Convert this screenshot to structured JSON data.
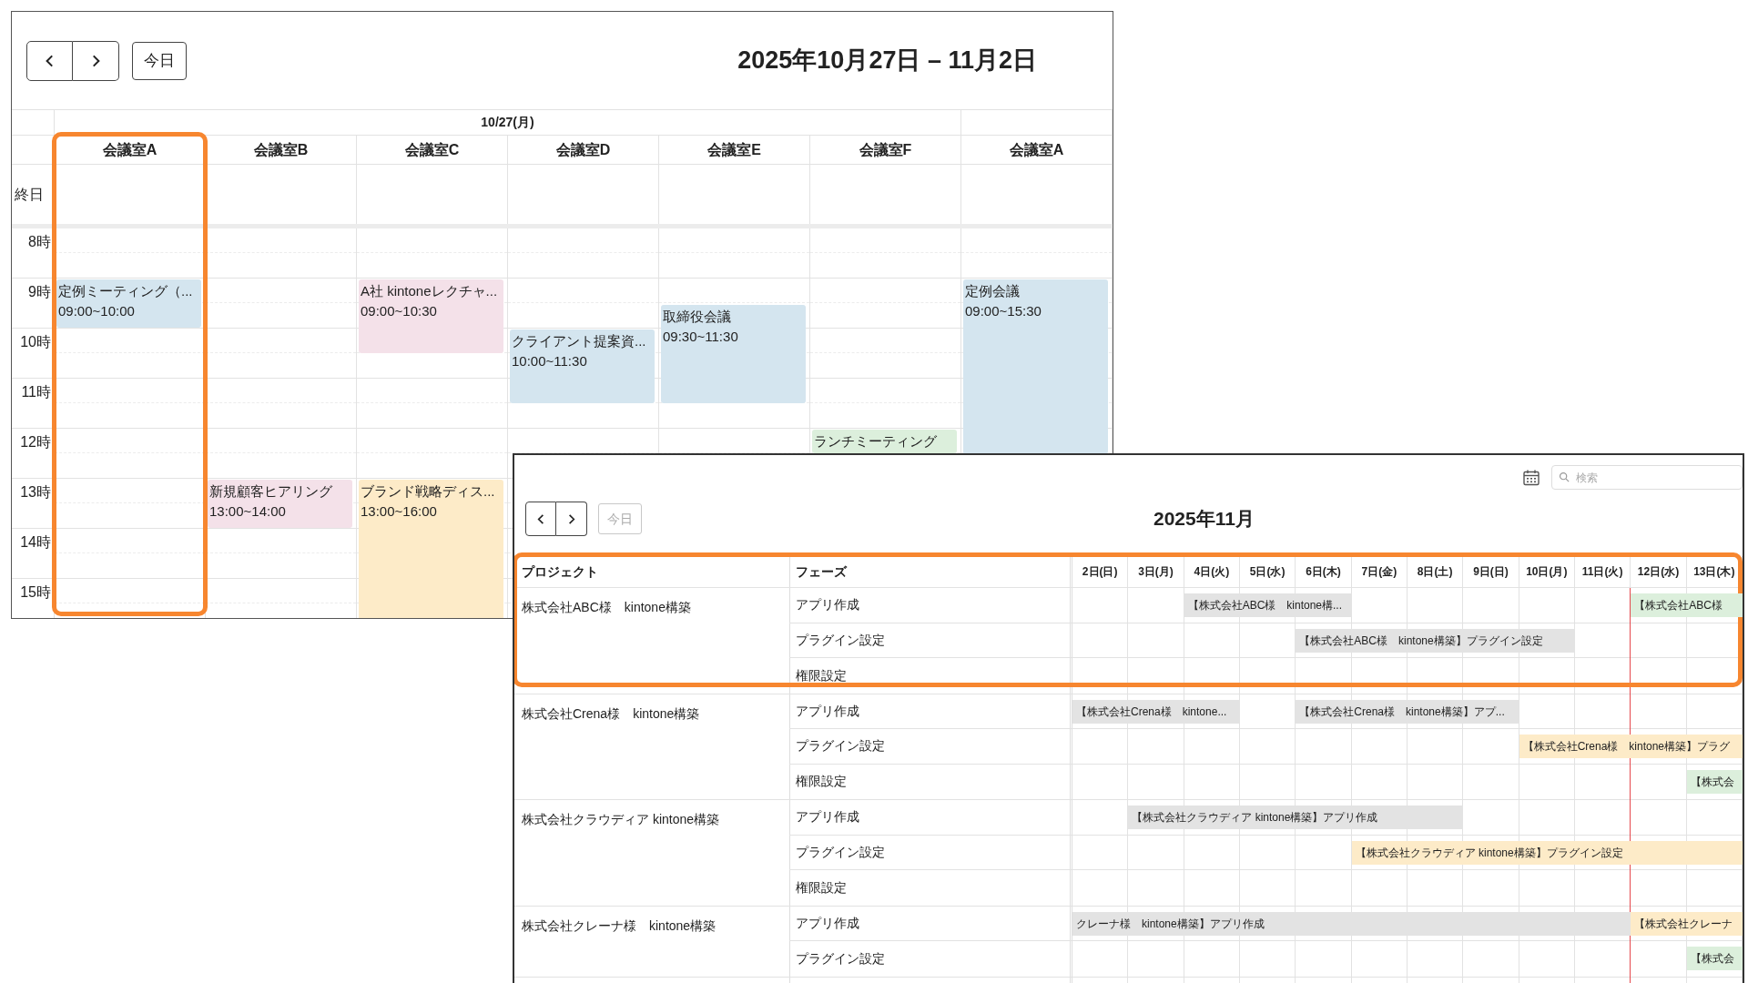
{
  "room_calendar": {
    "today_button": {
      "label": "今日",
      "disabled": false
    },
    "title": "2025年10月27日 – 11月2日",
    "all_day_label": "終日",
    "hours": [
      "8時",
      "9時",
      "10時",
      "11時",
      "12時",
      "13時",
      "14時",
      "15時"
    ],
    "date_groups": [
      {
        "label": "10/27(月)",
        "rooms": [
          {
            "name": "会議室A",
            "highlighted": true,
            "slots": [
              {
                "kind": "free"
              },
              {
                "kind": "free"
              },
              {
                "kind": "event",
                "title": "定例ミーティング（...",
                "time": "09:00~10:00",
                "color": "#d4e5ef"
              },
              {
                "kind": "continued"
              },
              {
                "kind": "free"
              },
              {
                "kind": "free"
              },
              {
                "kind": "free"
              },
              {
                "kind": "free"
              },
              {
                "kind": "free"
              },
              {
                "kind": "free"
              },
              {
                "kind": "free"
              },
              {
                "kind": "free"
              },
              {
                "kind": "free"
              },
              {
                "kind": "free"
              },
              {
                "kind": "free"
              },
              {
                "kind": "free"
              }
            ]
          },
          {
            "name": "会議室B",
            "highlighted": false,
            "slots": [
              {
                "kind": "free"
              },
              {
                "kind": "free"
              },
              {
                "kind": "free"
              },
              {
                "kind": "free"
              },
              {
                "kind": "free"
              },
              {
                "kind": "free"
              },
              {
                "kind": "free"
              },
              {
                "kind": "free"
              },
              {
                "kind": "free"
              },
              {
                "kind": "free"
              },
              {
                "kind": "event",
                "title": "新規顧客ヒアリング",
                "time": "13:00~14:00",
                "color": "#f4e1e9"
              },
              {
                "kind": "continued"
              },
              {
                "kind": "free"
              },
              {
                "kind": "free"
              },
              {
                "kind": "free"
              },
              {
                "kind": "free"
              }
            ]
          },
          {
            "name": "会議室C",
            "highlighted": false,
            "slots": [
              {
                "kind": "free"
              },
              {
                "kind": "free"
              },
              {
                "kind": "event",
                "title": "A社 kintoneレクチャ...",
                "time": "09:00~10:30",
                "color": "#f4e1e9"
              },
              {
                "kind": "continued"
              },
              {
                "kind": "continued"
              },
              {
                "kind": "free"
              },
              {
                "kind": "free"
              },
              {
                "kind": "free"
              },
              {
                "kind": "free"
              },
              {
                "kind": "free"
              },
              {
                "kind": "event",
                "title": "ブランド戦略ディス...",
                "time": "13:00~16:00",
                "color": "#fdebc8"
              },
              {
                "kind": "continued"
              },
              {
                "kind": "continued"
              },
              {
                "kind": "continued"
              },
              {
                "kind": "continued"
              },
              {
                "kind": "continued"
              }
            ]
          },
          {
            "name": "会議室D",
            "highlighted": false,
            "slots": [
              {
                "kind": "free"
              },
              {
                "kind": "free"
              },
              {
                "kind": "free"
              },
              {
                "kind": "free"
              },
              {
                "kind": "event",
                "title": "クライアント提案資...",
                "time": "10:00~11:30",
                "color": "#d4e5ef"
              },
              {
                "kind": "continued"
              },
              {
                "kind": "continued"
              },
              {
                "kind": "free"
              },
              {
                "kind": "free"
              },
              {
                "kind": "free"
              },
              {
                "kind": "free"
              },
              {
                "kind": "free"
              },
              {
                "kind": "free"
              },
              {
                "kind": "free"
              },
              {
                "kind": "free"
              },
              {
                "kind": "free"
              }
            ]
          },
          {
            "name": "会議室E",
            "highlighted": false,
            "slots": [
              {
                "kind": "free"
              },
              {
                "kind": "free"
              },
              {
                "kind": "free"
              },
              {
                "kind": "event",
                "title": "取締役会議",
                "time": "09:30~11:30",
                "color": "#d4e5ef"
              },
              {
                "kind": "continued"
              },
              {
                "kind": "continued"
              },
              {
                "kind": "continued"
              },
              {
                "kind": "free"
              },
              {
                "kind": "free"
              },
              {
                "kind": "free"
              },
              {
                "kind": "free"
              },
              {
                "kind": "free"
              },
              {
                "kind": "free"
              },
              {
                "kind": "free"
              },
              {
                "kind": "free"
              },
              {
                "kind": "free"
              }
            ]
          },
          {
            "name": "会議室F",
            "highlighted": false,
            "slots": [
              {
                "kind": "free"
              },
              {
                "kind": "free"
              },
              {
                "kind": "free"
              },
              {
                "kind": "free"
              },
              {
                "kind": "free"
              },
              {
                "kind": "free"
              },
              {
                "kind": "free"
              },
              {
                "kind": "free"
              },
              {
                "kind": "event",
                "title": "ランチミーティング",
                "color": "#dcefdc"
              },
              {
                "kind": "free"
              },
              {
                "kind": "free"
              },
              {
                "kind": "free"
              },
              {
                "kind": "free"
              },
              {
                "kind": "free"
              },
              {
                "kind": "free"
              },
              {
                "kind": "free"
              }
            ]
          }
        ]
      },
      {
        "rooms": [
          {
            "name": "会議室A",
            "highlighted": false,
            "slots": [
              {
                "kind": "free"
              },
              {
                "kind": "free"
              },
              {
                "kind": "event",
                "title": "定例会議",
                "time": "09:00~15:30",
                "color": "#d4e5ef"
              },
              {
                "kind": "continued"
              },
              {
                "kind": "continued"
              },
              {
                "kind": "continued"
              },
              {
                "kind": "continued"
              },
              {
                "kind": "continued"
              },
              {
                "kind": "continued"
              },
              {
                "kind": "continued"
              },
              {
                "kind": "continued"
              },
              {
                "kind": "continued"
              },
              {
                "kind": "continued"
              },
              {
                "kind": "continued"
              },
              {
                "kind": "continued"
              },
              {
                "kind": "free"
              }
            ]
          }
        ]
      }
    ]
  },
  "project_gantt": {
    "search": {
      "placeholder": "検索"
    },
    "today_button": {
      "label": "今日",
      "disabled": true
    },
    "title": "2025年11月",
    "columns": {
      "project": "プロジェクト",
      "phase": "フェーズ"
    },
    "days": [
      {
        "label": "2日(日)",
        "today": false
      },
      {
        "label": "3日(月)",
        "today": false
      },
      {
        "label": "4日(火)",
        "today": false
      },
      {
        "label": "5日(水)",
        "today": false
      },
      {
        "label": "6日(木)",
        "today": false
      },
      {
        "label": "7日(金)",
        "today": false
      },
      {
        "label": "8日(土)",
        "today": false
      },
      {
        "label": "9日(日)",
        "today": false
      },
      {
        "label": "10日(月)",
        "today": false
      },
      {
        "label": "11日(火)",
        "today": false
      },
      {
        "label": "12日(水)",
        "today": true
      },
      {
        "label": "13日(木)",
        "today": false
      }
    ],
    "projects": [
      {
        "name": "株式会社ABC様　kintone構築",
        "highlighted": true,
        "phases": [
          {
            "name": "アプリ作成",
            "cells": [
              {
                "kind": "empty"
              },
              {
                "kind": "empty"
              },
              {
                "kind": "bar",
                "text": "【株式会社ABC様　kintone構...",
                "color": "#e3e3e3"
              },
              {
                "kind": "continued"
              },
              {
                "kind": "continued"
              },
              {
                "kind": "empty"
              },
              {
                "kind": "empty"
              },
              {
                "kind": "empty"
              },
              {
                "kind": "empty"
              },
              {
                "kind": "empty"
              },
              {
                "kind": "bar",
                "text": "【株式会社ABC様",
                "color": "#dcefdc"
              },
              {
                "kind": "continued"
              }
            ]
          },
          {
            "name": "プラグイン設定",
            "cells": [
              {
                "kind": "empty"
              },
              {
                "kind": "empty"
              },
              {
                "kind": "empty"
              },
              {
                "kind": "empty"
              },
              {
                "kind": "bar",
                "text": "【株式会社ABC様　kintone構築】プラグイン設定",
                "color": "#e3e3e3"
              },
              {
                "kind": "continued"
              },
              {
                "kind": "continued"
              },
              {
                "kind": "continued"
              },
              {
                "kind": "continued"
              },
              {
                "kind": "empty"
              },
              {
                "kind": "empty"
              },
              {
                "kind": "empty"
              }
            ]
          },
          {
            "name": "権限設定",
            "cells": [
              {
                "kind": "empty"
              },
              {
                "kind": "empty"
              },
              {
                "kind": "empty"
              },
              {
                "kind": "empty"
              },
              {
                "kind": "empty"
              },
              {
                "kind": "empty"
              },
              {
                "kind": "empty"
              },
              {
                "kind": "empty"
              },
              {
                "kind": "empty"
              },
              {
                "kind": "empty"
              },
              {
                "kind": "empty"
              },
              {
                "kind": "empty"
              }
            ]
          }
        ]
      },
      {
        "name": "株式会社Crena様　kintone構築",
        "highlighted": false,
        "phases": [
          {
            "name": "アプリ作成",
            "cells": [
              {
                "kind": "bar",
                "text": "【株式会社Crena様　kintone...",
                "color": "#e3e3e3"
              },
              {
                "kind": "continued"
              },
              {
                "kind": "continued"
              },
              {
                "kind": "empty"
              },
              {
                "kind": "bar",
                "text": "【株式会社Crena様　kintone構築】アプ...",
                "color": "#e3e3e3"
              },
              {
                "kind": "continued"
              },
              {
                "kind": "continued"
              },
              {
                "kind": "continued"
              },
              {
                "kind": "empty"
              },
              {
                "kind": "empty"
              },
              {
                "kind": "empty"
              },
              {
                "kind": "empty"
              }
            ]
          },
          {
            "name": "プラグイン設定",
            "cells": [
              {
                "kind": "empty"
              },
              {
                "kind": "empty"
              },
              {
                "kind": "empty"
              },
              {
                "kind": "empty"
              },
              {
                "kind": "empty"
              },
              {
                "kind": "empty"
              },
              {
                "kind": "empty"
              },
              {
                "kind": "empty"
              },
              {
                "kind": "bar",
                "text": "【株式会社Crena様　kintone構築】プラグ",
                "color": "#fdebc8"
              },
              {
                "kind": "continued"
              },
              {
                "kind": "continued"
              },
              {
                "kind": "continued"
              }
            ]
          },
          {
            "name": "権限設定",
            "cells": [
              {
                "kind": "empty"
              },
              {
                "kind": "empty"
              },
              {
                "kind": "empty"
              },
              {
                "kind": "empty"
              },
              {
                "kind": "empty"
              },
              {
                "kind": "empty"
              },
              {
                "kind": "empty"
              },
              {
                "kind": "empty"
              },
              {
                "kind": "empty"
              },
              {
                "kind": "empty"
              },
              {
                "kind": "empty"
              },
              {
                "kind": "bar",
                "text": "【株式会",
                "color": "#dcefdc"
              }
            ]
          }
        ]
      },
      {
        "name": "株式会社クラウディア kintone構築",
        "highlighted": false,
        "phases": [
          {
            "name": "アプリ作成",
            "cells": [
              {
                "kind": "empty"
              },
              {
                "kind": "bar",
                "text": "【株式会社クラウディア kintone構築】アプリ作成",
                "color": "#e3e3e3"
              },
              {
                "kind": "continued"
              },
              {
                "kind": "continued"
              },
              {
                "kind": "continued"
              },
              {
                "kind": "continued"
              },
              {
                "kind": "continued"
              },
              {
                "kind": "empty"
              },
              {
                "kind": "empty"
              },
              {
                "kind": "empty"
              },
              {
                "kind": "empty"
              },
              {
                "kind": "empty"
              }
            ]
          },
          {
            "name": "プラグイン設定",
            "cells": [
              {
                "kind": "empty"
              },
              {
                "kind": "empty"
              },
              {
                "kind": "empty"
              },
              {
                "kind": "empty"
              },
              {
                "kind": "empty"
              },
              {
                "kind": "bar",
                "text": "【株式会社クラウディア kintone構築】プラグイン設定",
                "color": "#fdebc8"
              },
              {
                "kind": "continued"
              },
              {
                "kind": "continued"
              },
              {
                "kind": "continued"
              },
              {
                "kind": "continued"
              },
              {
                "kind": "continued"
              },
              {
                "kind": "continued"
              }
            ]
          },
          {
            "name": "権限設定",
            "cells": [
              {
                "kind": "empty"
              },
              {
                "kind": "empty"
              },
              {
                "kind": "empty"
              },
              {
                "kind": "empty"
              },
              {
                "kind": "empty"
              },
              {
                "kind": "empty"
              },
              {
                "kind": "empty"
              },
              {
                "kind": "empty"
              },
              {
                "kind": "empty"
              },
              {
                "kind": "empty"
              },
              {
                "kind": "empty"
              },
              {
                "kind": "empty"
              }
            ]
          }
        ]
      },
      {
        "name": "株式会社クレーナ様　kintone構築",
        "highlighted": false,
        "phases": [
          {
            "name": "アプリ作成",
            "cells": [
              {
                "kind": "bar",
                "text": "クレーナ様　kintone構築】アプリ作成",
                "color": "#e3e3e3"
              },
              {
                "kind": "continued"
              },
              {
                "kind": "continued"
              },
              {
                "kind": "continued"
              },
              {
                "kind": "continued"
              },
              {
                "kind": "continued"
              },
              {
                "kind": "continued"
              },
              {
                "kind": "continued"
              },
              {
                "kind": "continued"
              },
              {
                "kind": "continued"
              },
              {
                "kind": "bar",
                "text": "【株式会社クレーナ",
                "color": "#fdebc8"
              },
              {
                "kind": "continued"
              }
            ]
          },
          {
            "name": "プラグイン設定",
            "cells": [
              {
                "kind": "empty"
              },
              {
                "kind": "empty"
              },
              {
                "kind": "empty"
              },
              {
                "kind": "empty"
              },
              {
                "kind": "empty"
              },
              {
                "kind": "empty"
              },
              {
                "kind": "empty"
              },
              {
                "kind": "empty"
              },
              {
                "kind": "empty"
              },
              {
                "kind": "empty"
              },
              {
                "kind": "empty"
              },
              {
                "kind": "bar",
                "text": "【株式会",
                "color": "#dcefdc"
              }
            ]
          }
        ]
      }
    ]
  }
}
